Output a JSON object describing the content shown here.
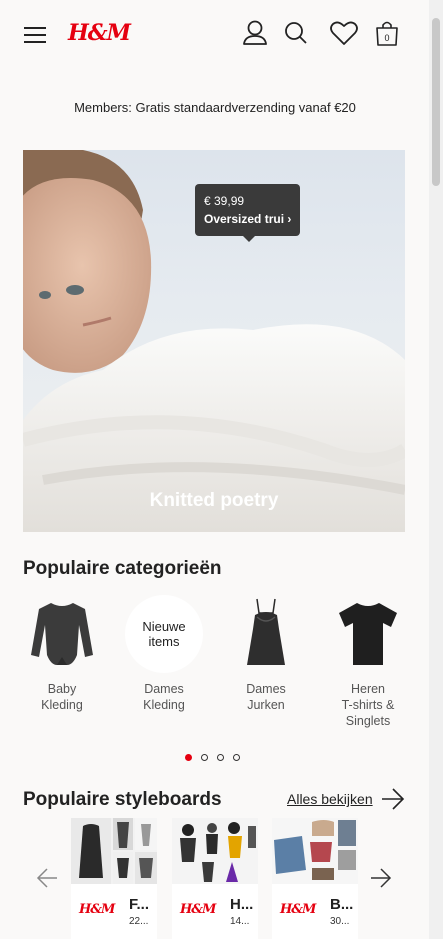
{
  "header": {
    "logo": "H&M",
    "cart_count": "0"
  },
  "promo": {
    "text": "Members: Gratis standaardverzending vanaf €20"
  },
  "hero": {
    "title": "Knitted poetry",
    "tooltip_price": "€ 39,99",
    "tooltip_product": "Oversized trui ›"
  },
  "categories": {
    "title": "Populaire categorieën",
    "items": [
      {
        "label1": "Baby",
        "label2": "Kleding"
      },
      {
        "bubble1": "Nieuwe",
        "bubble2": "items",
        "label1": "Dames",
        "label2": "Kleding"
      },
      {
        "label1": "Dames",
        "label2": "Jurken"
      },
      {
        "label1": "Heren",
        "label2": "T-shirts &",
        "label3": "Singlets"
      }
    ],
    "carousel_dots": 4,
    "active_dot": 1
  },
  "styleboards": {
    "title": "Populaire styleboards",
    "view_all": "Alles bekijken",
    "boards": [
      {
        "logo": "H&M",
        "title": "F...",
        "count": "22..."
      },
      {
        "logo": "H&M",
        "title": "H...",
        "count": "14..."
      },
      {
        "logo": "H&M",
        "title": "B...",
        "count": "30..."
      }
    ]
  },
  "colors": {
    "brand": "#e50010",
    "background": "#faf9f8",
    "tooltip": "#3a3a3a"
  }
}
